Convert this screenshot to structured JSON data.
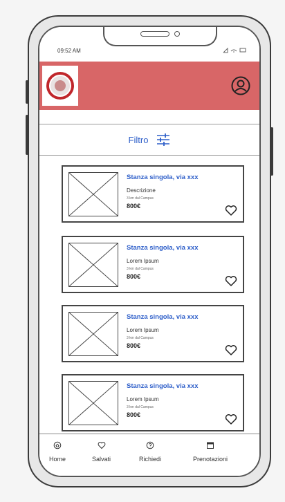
{
  "status_bar": {
    "time": "09:52 AM",
    "icons": "signal wifi battery"
  },
  "header": {
    "logo_name": "university-seal-logo",
    "profile_icon": "profile-icon",
    "accent_color": "#d86667"
  },
  "filter": {
    "label": "Filtro",
    "icon": "sliders-icon"
  },
  "listings": [
    {
      "title": "Stanza singola, via xxx",
      "description": "Descrizione",
      "distance": "3 km dal Campus",
      "price": "800€"
    },
    {
      "title": "Stanza singola, via xxx",
      "description": "Lorem Ipsum",
      "distance": "3 km dal Campus",
      "price": "800€"
    },
    {
      "title": "Stanza singola, via xxx",
      "description": "Lorem Ipsum",
      "distance": "3 km dal Campus",
      "price": "800€"
    },
    {
      "title": "Stanza singola, via xxx",
      "description": "Lorem Ipsum",
      "distance": "3 km dal Campus",
      "price": "800€"
    }
  ],
  "nav": {
    "home": "Home",
    "saved": "Salvati",
    "requests": "Richiedi",
    "bookings": "Prenotazioni"
  }
}
